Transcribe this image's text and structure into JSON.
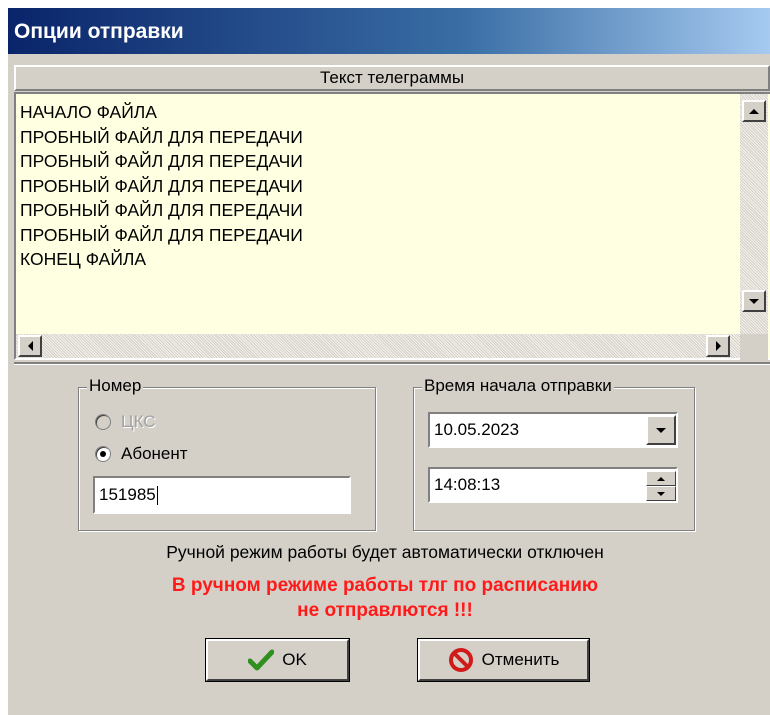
{
  "window": {
    "title": "Опции отправки"
  },
  "telegram": {
    "header": "Текст телеграммы",
    "lines": [
      "НАЧАЛО ФАЙЛА",
      "ПРОБНЫЙ ФАЙЛ ДЛЯ ПЕРЕДАЧИ",
      "ПРОБНЫЙ ФАЙЛ ДЛЯ ПЕРЕДАЧИ",
      "ПРОБНЫЙ ФАЙЛ ДЛЯ ПЕРЕДАЧИ",
      "ПРОБНЫЙ ФАЙЛ ДЛЯ ПЕРЕДАЧИ",
      "ПРОБНЫЙ ФАЙЛ ДЛЯ ПЕРЕДАЧИ",
      "КОНЕЦ ФАЙЛА"
    ]
  },
  "number": {
    "legend": "Номер",
    "options": [
      {
        "label": "ЦКС",
        "selected": false,
        "disabled": true
      },
      {
        "label": "Абонент",
        "selected": true,
        "disabled": false
      }
    ],
    "value": "151985"
  },
  "start_time": {
    "legend": "Время начала отправки",
    "date": "10.05.2023",
    "time": "14:08:13"
  },
  "info_text": "Ручной режим работы  будет автоматически отключен",
  "warning": {
    "line1": "В ручном режиме работы тлг по расписанию",
    "line2": "не отправлются !!!",
    "color": "#ff1a1a"
  },
  "buttons": {
    "ok": "OK",
    "cancel": "Отменить"
  },
  "colors": {
    "title_bar": "#0a246a",
    "text_bg": "#ffffe1",
    "dialog_bg": "#d4d0c8"
  }
}
